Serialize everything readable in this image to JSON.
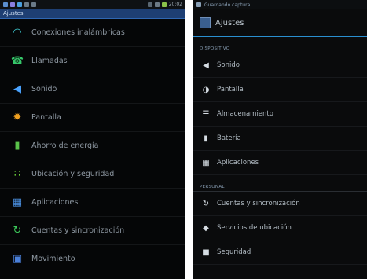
{
  "left": {
    "statusbar": {
      "time": "20:02"
    },
    "title": "Ajustes",
    "items": [
      {
        "label": "Conexiones inalámbricas",
        "icon": "wifi-icon",
        "color": "#3fd0d8"
      },
      {
        "label": "Llamadas",
        "icon": "phone-icon",
        "color": "#36c76a"
      },
      {
        "label": "Sonido",
        "icon": "speaker-icon",
        "color": "#4aa3ff"
      },
      {
        "label": "Pantalla",
        "icon": "sun-icon",
        "color": "#f0a020"
      },
      {
        "label": "Ahorro de energía",
        "icon": "battery-icon",
        "color": "#5ac24a"
      },
      {
        "label": "Ubicación y seguridad",
        "icon": "grid-icon",
        "color": "#6cd23a"
      },
      {
        "label": "Aplicaciones",
        "icon": "apps-icon",
        "color": "#4a8fe0"
      },
      {
        "label": "Cuentas y sincronización",
        "icon": "sync-icon",
        "color": "#3cc95a"
      },
      {
        "label": "Movimiento",
        "icon": "motion-icon",
        "color": "#4a7fd8"
      }
    ]
  },
  "right": {
    "notification": "Guardando captura",
    "title": "Ajustes",
    "sections": [
      {
        "label": "DISPOSITIVO",
        "items": [
          {
            "label": "Sonido",
            "icon": "speaker-icon"
          },
          {
            "label": "Pantalla",
            "icon": "brightness-icon"
          },
          {
            "label": "Almacenamiento",
            "icon": "storage-icon"
          },
          {
            "label": "Batería",
            "icon": "battery-icon"
          },
          {
            "label": "Aplicaciones",
            "icon": "apps-icon"
          }
        ]
      },
      {
        "label": "PERSONAL",
        "items": [
          {
            "label": "Cuentas y sincronización",
            "icon": "sync-icon"
          },
          {
            "label": "Servicios de ubicación",
            "icon": "location-icon"
          },
          {
            "label": "Seguridad",
            "icon": "lock-icon"
          }
        ]
      }
    ]
  }
}
